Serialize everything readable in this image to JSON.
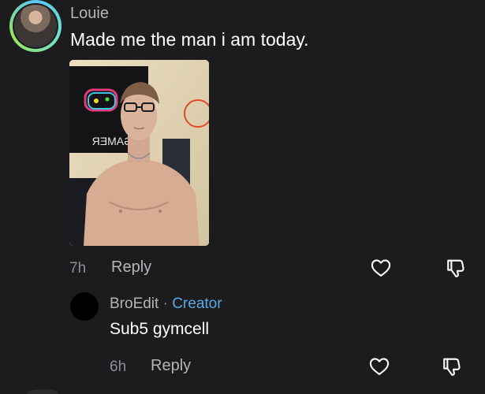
{
  "comment": {
    "username": "Louie",
    "text": "Made me the man i am today.",
    "timestamp": "7h",
    "reply_label": "Reply"
  },
  "photo": {
    "poster_text": "GAMER",
    "icon": "gamer-poster-photo"
  },
  "reply": {
    "username": "BroEdit",
    "separator": "·",
    "badge": "Creator",
    "text": "Sub5 gymcell",
    "timestamp": "6h",
    "reply_label": "Reply"
  },
  "icons": {
    "like": "heart-icon",
    "dislike": "thumbs-down-icon"
  },
  "colors": {
    "background": "#1c1c1e",
    "creator_badge": "#5aa9e6",
    "muted_text": "#8e8e93"
  }
}
